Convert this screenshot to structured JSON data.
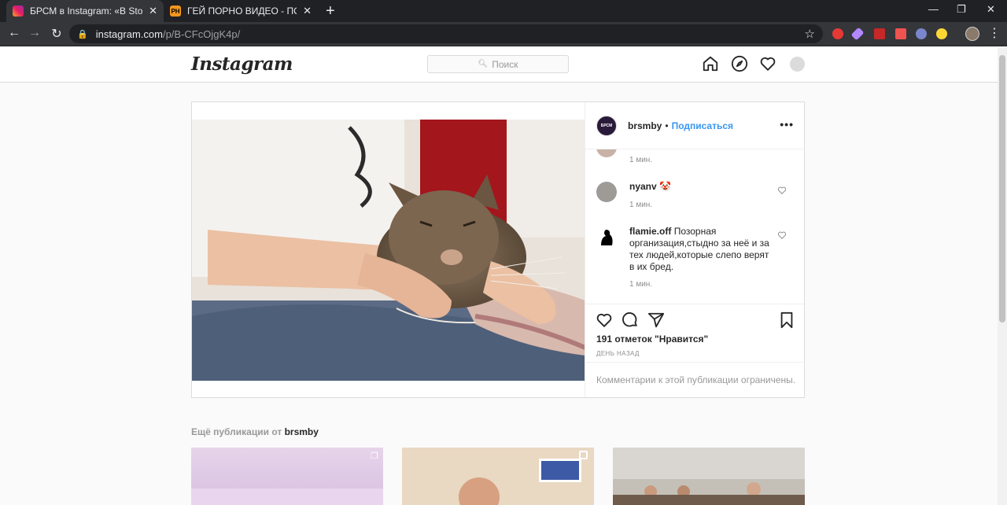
{
  "browser": {
    "tabs": [
      {
        "title": "БРСМ в Instagram: «В Stories по",
        "favicon": "instagram-icon",
        "active": true
      },
      {
        "title": "ГЕЙ ПОРНО ВИДЕО - ПОРНХАБ",
        "favicon": "ph-icon",
        "active": false
      }
    ],
    "url_host": "instagram.com",
    "url_path": "/p/B-CFcOjgK4p/"
  },
  "header": {
    "logo": "Instagram",
    "search_placeholder": "Поиск",
    "icons": [
      "home-icon",
      "explore-icon",
      "activity-heart-icon",
      "profile-icon"
    ]
  },
  "post": {
    "author": "brsmby",
    "separator": "•",
    "follow_label": "Подписаться",
    "avatar_text": "БРСМ",
    "comments": [
      {
        "username": "",
        "text": "",
        "time": "1 мин."
      },
      {
        "username": "nyanv",
        "text": "🤡",
        "time": "1 мин."
      },
      {
        "username": "flamie.off",
        "text": "Позорная организация,стыдно за неё и за тех людей,которые слепо верят в их бред.",
        "time": "1 мин."
      }
    ],
    "likes_text": "191 отметок \"Нравится\"",
    "posted_time": "ДЕНЬ НАЗАД",
    "comments_restricted": "Комментарии к этой публикации ограничены."
  },
  "more_posts": {
    "prefix": "Ещё публикации от",
    "author": "brsmby"
  },
  "colors": {
    "link_blue": "#3897f0",
    "text": "#262626",
    "muted": "#8e8e8e",
    "border": "#dbdbdb"
  }
}
